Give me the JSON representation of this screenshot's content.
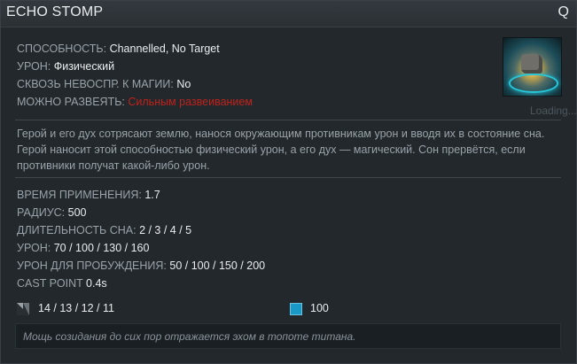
{
  "header": {
    "ability_name": "ECHO STOMP",
    "hotkey": "Q"
  },
  "stats_top": [
    {
      "label": "СПОСОБНОСТЬ:",
      "value": "Channelled, No Target"
    },
    {
      "label": "УРОН:",
      "value": "Физический"
    },
    {
      "label": "СКВОЗЬ НЕВОСПР. К МАГИИ:",
      "value": "No"
    },
    {
      "label": "МОЖНО РАЗВЕЯТЬ:",
      "value": "Сильным развеиванием",
      "value_color": "#c0221b"
    }
  ],
  "portrait": {
    "icon": "echo-stomp-ability-icon",
    "loading_text": "Loading..."
  },
  "description": "Герой и его дух сотрясают землю, нанося окружающим противникам урон и вводя их в состояние сна. Герой наносит этой способностью физический урон, а его дух — магический. Сон прервётся, если противники получат какой-либо урон.",
  "stats_bottom": [
    {
      "label": "ВРЕМЯ ПРИМЕНЕНИЯ:",
      "value": "1.7"
    },
    {
      "label": "РАДИУС:",
      "value": "500"
    },
    {
      "label": "ДЛИТЕЛЬНОСТЬ СНА:",
      "value": "2 / 3 / 4 / 5"
    },
    {
      "label": "УРОН:",
      "value": "70 / 100 / 130 / 160"
    },
    {
      "label": "УРОН ДЛЯ ПРОБУЖДЕНИЯ:",
      "value": "50 / 100 / 150 / 200"
    },
    {
      "label": "CAST POINT",
      "value": "0.4s"
    }
  ],
  "costs": {
    "cooldown": {
      "icon": "cooldown-icon",
      "value": "14 / 13 / 12 / 11"
    },
    "mana": {
      "icon": "mana-icon",
      "value": "100",
      "color": "#1a98c6"
    }
  },
  "lore": "Мощь созидания до сих пор отражается эхом в топоте титана."
}
